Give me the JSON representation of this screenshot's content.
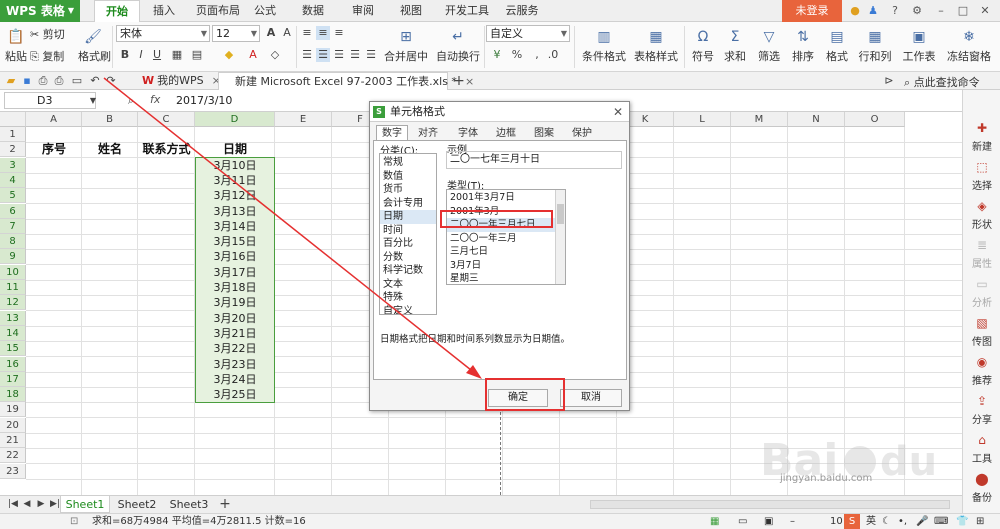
{
  "app": {
    "logo": "WPS 表格",
    "login": "未登录"
  },
  "menu_tabs": [
    "开始",
    "插入",
    "页面布局",
    "公式",
    "数据",
    "审阅",
    "视图",
    "开发工具",
    "云服务"
  ],
  "ribbon": {
    "paste": "粘贴",
    "cut": "剪切",
    "copy": "复制",
    "format_painter": "格式刷",
    "font_name": "宋体",
    "font_size": "12",
    "merge_center": "合并居中",
    "auto_wrap": "自动换行",
    "number_format": "自定义",
    "conditional_format": "条件格式",
    "table_style": "表格样式",
    "symbol": "符号",
    "sum": "求和",
    "filter": "筛选",
    "sort": "排序",
    "format": "格式",
    "row_col": "行和列",
    "worksheet": "工作表",
    "freeze": "冻结窗格"
  },
  "doc_tabs": {
    "tab1": "我的WPS",
    "tab2": "新建 Microsoft Excel 97-2003 工作表.xls *",
    "help": "点此查找命令"
  },
  "formula_bar": {
    "name_box": "D3",
    "fx": "fx",
    "content": "2017/3/10"
  },
  "columns": [
    "A",
    "B",
    "C",
    "D",
    "E",
    "F",
    "G",
    "H",
    "I",
    "J",
    "K",
    "L",
    "M",
    "N",
    "O"
  ],
  "rows": [
    "1",
    "2",
    "3",
    "4",
    "5",
    "6",
    "7",
    "8",
    "9",
    "10",
    "11",
    "12",
    "13",
    "14",
    "15",
    "16",
    "17",
    "18",
    "19",
    "20",
    "21",
    "22",
    "23"
  ],
  "sheet": {
    "headers": {
      "a": "序号",
      "b": "姓名",
      "c": "联系方式",
      "d": "日期"
    },
    "dates": [
      "3月10日",
      "3月11日",
      "3月12日",
      "3月13日",
      "3月14日",
      "3月15日",
      "3月16日",
      "3月17日",
      "3月18日",
      "3月19日",
      "3月20日",
      "3月21日",
      "3月22日",
      "3月23日",
      "3月24日",
      "3月25日"
    ]
  },
  "sheet_tabs": [
    "Sheet1",
    "Sheet2",
    "Sheet3"
  ],
  "status": {
    "text": "求和=68万4984  平均值=4万2811.5  计数=16",
    "zoom": "10"
  },
  "right_panel": [
    {
      "label": "新建",
      "icon": "new-icon",
      "disabled": false
    },
    {
      "label": "选择",
      "icon": "select-icon",
      "disabled": false
    },
    {
      "label": "形状",
      "icon": "shape-icon",
      "disabled": false
    },
    {
      "label": "属性",
      "icon": "property-icon",
      "disabled": true
    },
    {
      "label": "分析",
      "icon": "analysis-icon",
      "disabled": true
    },
    {
      "label": "传图",
      "icon": "upload-image-icon",
      "disabled": false
    },
    {
      "label": "推荐",
      "icon": "recommend-icon",
      "disabled": false
    },
    {
      "label": "分享",
      "icon": "share-icon",
      "disabled": false
    },
    {
      "label": "工具",
      "icon": "tools-icon",
      "disabled": false
    },
    {
      "label": "备份",
      "icon": "backup-icon",
      "disabled": false
    }
  ],
  "dialog": {
    "title": "单元格格式",
    "tabs": [
      "数字",
      "对齐",
      "字体",
      "边框",
      "图案",
      "保护"
    ],
    "category_label": "分类(C):",
    "categories": [
      "常规",
      "数值",
      "货币",
      "会计专用",
      "日期",
      "时间",
      "百分比",
      "分数",
      "科学记数",
      "文本",
      "特殊",
      "自定义"
    ],
    "selected_category": "日期",
    "sample_label": "示例",
    "sample_value": "二〇一七年三月十日",
    "type_label": "类型(T):",
    "types": [
      "2001年3月7日",
      "2001年3月",
      "二〇〇一年三月七日",
      "二〇〇一年三月",
      "三月七日",
      "3月7日",
      "星期三"
    ],
    "selected_type": "二〇〇一年三月七日",
    "description": "日期格式把日期和时间系列数显示为日期值。",
    "ok": "确定",
    "cancel": "取消"
  },
  "watermark": {
    "text": "jingyan.baidu.com"
  },
  "colors": {
    "brand_green": "#3b9e3b",
    "login_orange": "#e8643c",
    "annotation_red": "#e53030",
    "selection_fill": "#e6f2df"
  }
}
